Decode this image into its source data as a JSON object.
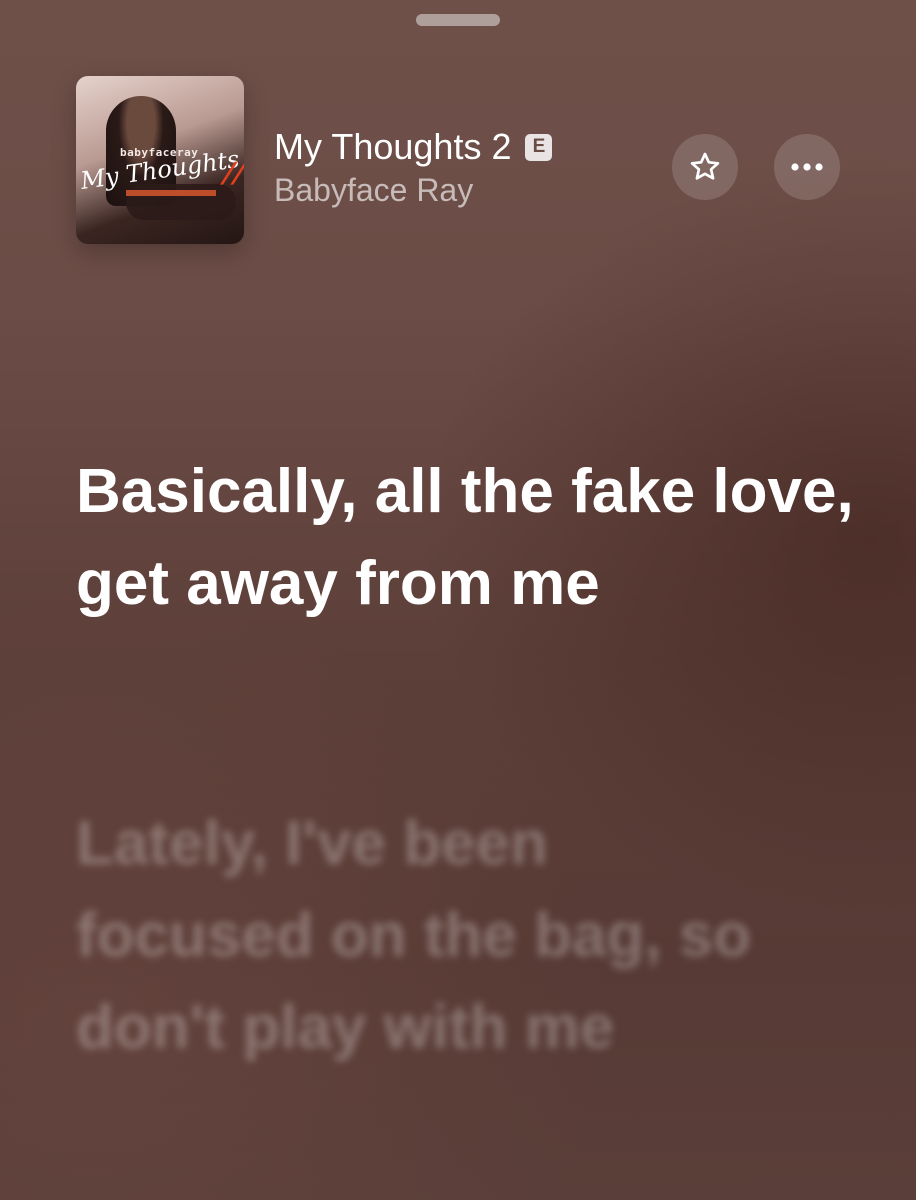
{
  "header": {
    "artwork": {
      "brand": "babyfaceray",
      "title": "My Thoughts",
      "mark": "//"
    },
    "song_title": "My Thoughts 2",
    "explicit_badge": "E",
    "artist": "Babyface Ray",
    "icons": {
      "favorite": "star-icon",
      "more": "ellipsis-icon"
    }
  },
  "lyrics": {
    "current_line": "Basically, all the fake love, get away from me",
    "next_line": "Lately, I've been focused on the bag, so don't play with me"
  },
  "colors": {
    "background_top": "#6e5049",
    "background_bottom": "#573a35",
    "text_active": "#ffffff",
    "text_inactive": "rgba(255,255,255,0.28)",
    "artist_text": "rgba(255,255,255,0.62)"
  }
}
